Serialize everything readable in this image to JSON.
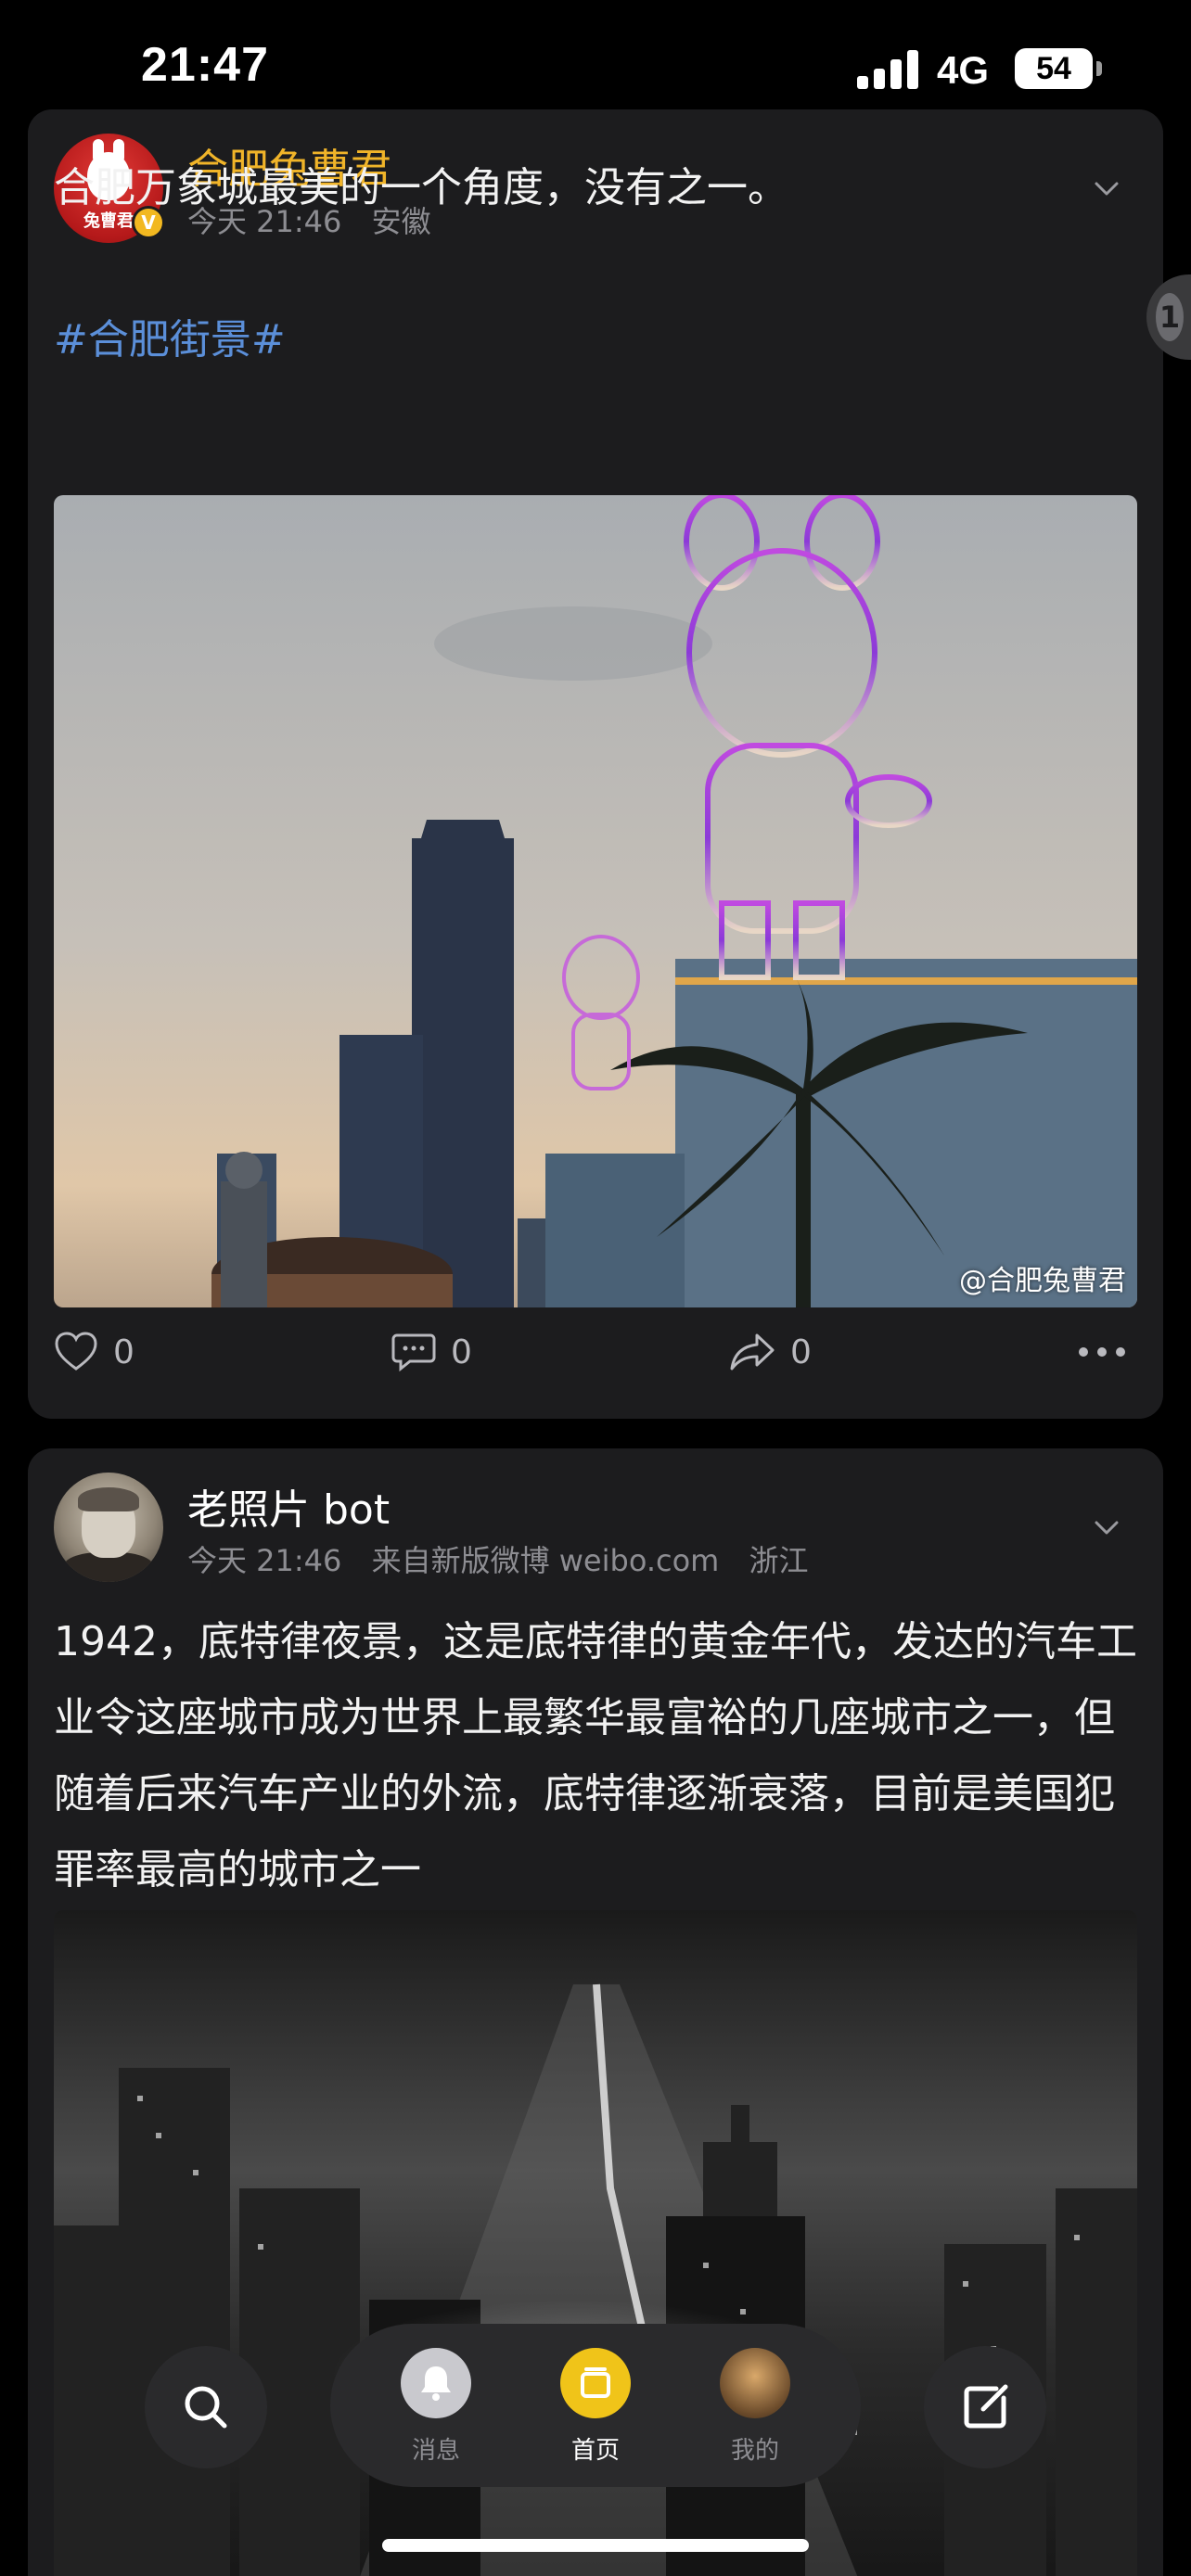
{
  "status_bar": {
    "time": "21:47",
    "network": "4G",
    "battery": "54"
  },
  "posts": [
    {
      "author": "合肥兔曹君",
      "avatar_text": "兔曹君",
      "verified_badge": "V",
      "time": "今天 21:46",
      "location": "安徽",
      "text": "合肥万象城最美的一个角度，没有之一。",
      "hashtag": "#合肥街景#",
      "watermark": "@合肥兔曹君",
      "likes": "0",
      "comments": "0",
      "shares": "0"
    },
    {
      "author": "老照片 bot",
      "time": "今天 21:46",
      "source": "来自新版微博 weibo.com",
      "location": "浙江",
      "text": "1942，底特律夜景，这是底特律的黄金年代，发达的汽车工业令这座城市成为世界上最繁华最富裕的几座城市之一，但随着后来汽车产业的外流，底特律逐渐衰落，目前是美国犯罪率最高的城市之一"
    }
  ],
  "side_tab": {
    "label": "1"
  },
  "nav": {
    "messages": "消息",
    "home": "首页",
    "me": "我的"
  },
  "colors": {
    "accent_gold": "#f0b429",
    "hashtag_blue": "#5b8fd9",
    "card_bg": "#1c1c1e"
  }
}
